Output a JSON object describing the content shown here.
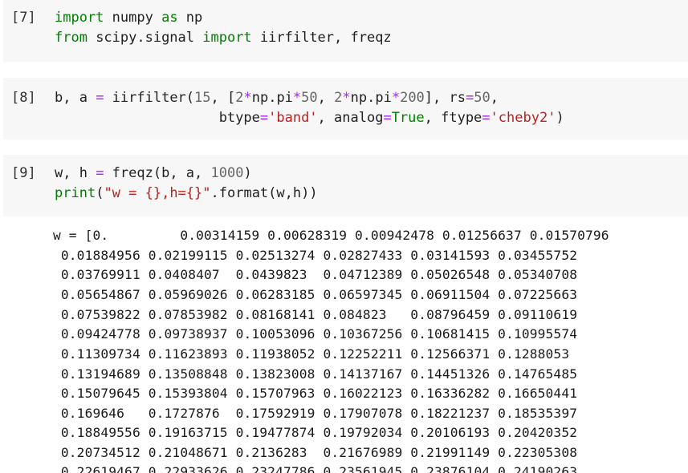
{
  "cells": [
    {
      "prompt": "[7]",
      "lines": [
        [
          {
            "t": "import",
            "c": "kw"
          },
          {
            "t": " numpy ",
            "c": ""
          },
          {
            "t": "as",
            "c": "kw"
          },
          {
            "t": " np",
            "c": ""
          }
        ],
        [
          {
            "t": "from",
            "c": "kw"
          },
          {
            "t": " scipy.signal ",
            "c": ""
          },
          {
            "t": "import",
            "c": "kw"
          },
          {
            "t": " iirfilter, freqz",
            "c": ""
          }
        ]
      ]
    },
    {
      "prompt": "[8]",
      "lines": [
        [
          {
            "t": "b, a ",
            "c": ""
          },
          {
            "t": "=",
            "c": "op"
          },
          {
            "t": " iirfilter(",
            "c": ""
          },
          {
            "t": "15",
            "c": "num"
          },
          {
            "t": ", [",
            "c": ""
          },
          {
            "t": "2",
            "c": "num"
          },
          {
            "t": "*",
            "c": "op"
          },
          {
            "t": "np.pi",
            "c": ""
          },
          {
            "t": "*",
            "c": "op"
          },
          {
            "t": "50",
            "c": "num"
          },
          {
            "t": ", ",
            "c": ""
          },
          {
            "t": "2",
            "c": "num"
          },
          {
            "t": "*",
            "c": "op"
          },
          {
            "t": "np.pi",
            "c": ""
          },
          {
            "t": "*",
            "c": "op"
          },
          {
            "t": "200",
            "c": "num"
          },
          {
            "t": "], rs",
            "c": ""
          },
          {
            "t": "=",
            "c": "op"
          },
          {
            "t": "50",
            "c": "num"
          },
          {
            "t": ",",
            "c": ""
          }
        ],
        [
          {
            "t": "                    btype",
            "c": ""
          },
          {
            "t": "=",
            "c": "op"
          },
          {
            "t": "'band'",
            "c": "str"
          },
          {
            "t": ", analog",
            "c": ""
          },
          {
            "t": "=",
            "c": "op"
          },
          {
            "t": "True",
            "c": "kw"
          },
          {
            "t": ", ftype",
            "c": ""
          },
          {
            "t": "=",
            "c": "op"
          },
          {
            "t": "'cheby2'",
            "c": "str"
          },
          {
            "t": ")",
            "c": ""
          }
        ]
      ]
    },
    {
      "prompt": "[9]",
      "lines": [
        [
          {
            "t": "w, h ",
            "c": ""
          },
          {
            "t": "=",
            "c": "op"
          },
          {
            "t": " freqz(b, a, ",
            "c": ""
          },
          {
            "t": "1000",
            "c": "num"
          },
          {
            "t": ")",
            "c": ""
          }
        ],
        [
          {
            "t": "print",
            "c": "kw"
          },
          {
            "t": "(",
            "c": ""
          },
          {
            "t": "\"w = {},h={}\"",
            "c": "str"
          },
          {
            "t": ".",
            "c": ""
          },
          {
            "t": "format",
            "c": ""
          },
          {
            "t": "(w,h))",
            "c": ""
          }
        ]
      ]
    }
  ],
  "output_lines": [
    "w = [0.         0.00314159 0.00628319 0.00942478 0.01256637 0.01570796",
    " 0.01884956 0.02199115 0.02513274 0.02827433 0.03141593 0.03455752",
    " 0.03769911 0.0408407  0.0439823  0.04712389 0.05026548 0.05340708",
    " 0.05654867 0.05969026 0.06283185 0.06597345 0.06911504 0.07225663",
    " 0.07539822 0.07853982 0.08168141 0.084823   0.08796459 0.09110619",
    " 0.09424778 0.09738937 0.10053096 0.10367256 0.10681415 0.10995574",
    " 0.11309734 0.11623893 0.11938052 0.12252211 0.12566371 0.1288053",
    " 0.13194689 0.13508848 0.13823008 0.14137167 0.14451326 0.14765485",
    " 0.15079645 0.15393804 0.15707963 0.16022123 0.16336282 0.16650441",
    " 0.169646   0.1727876  0.17592919 0.17907078 0.18221237 0.18535397",
    " 0.18849556 0.19163715 0.19477874 0.19792034 0.20106193 0.20420352",
    " 0.20734512 0.21048671 0.2136283  0.21676989 0.21991149 0.22305308",
    " 0.22619467 0.22933626 0.23247786 0.23561945 0.23876104 0.24190263"
  ]
}
